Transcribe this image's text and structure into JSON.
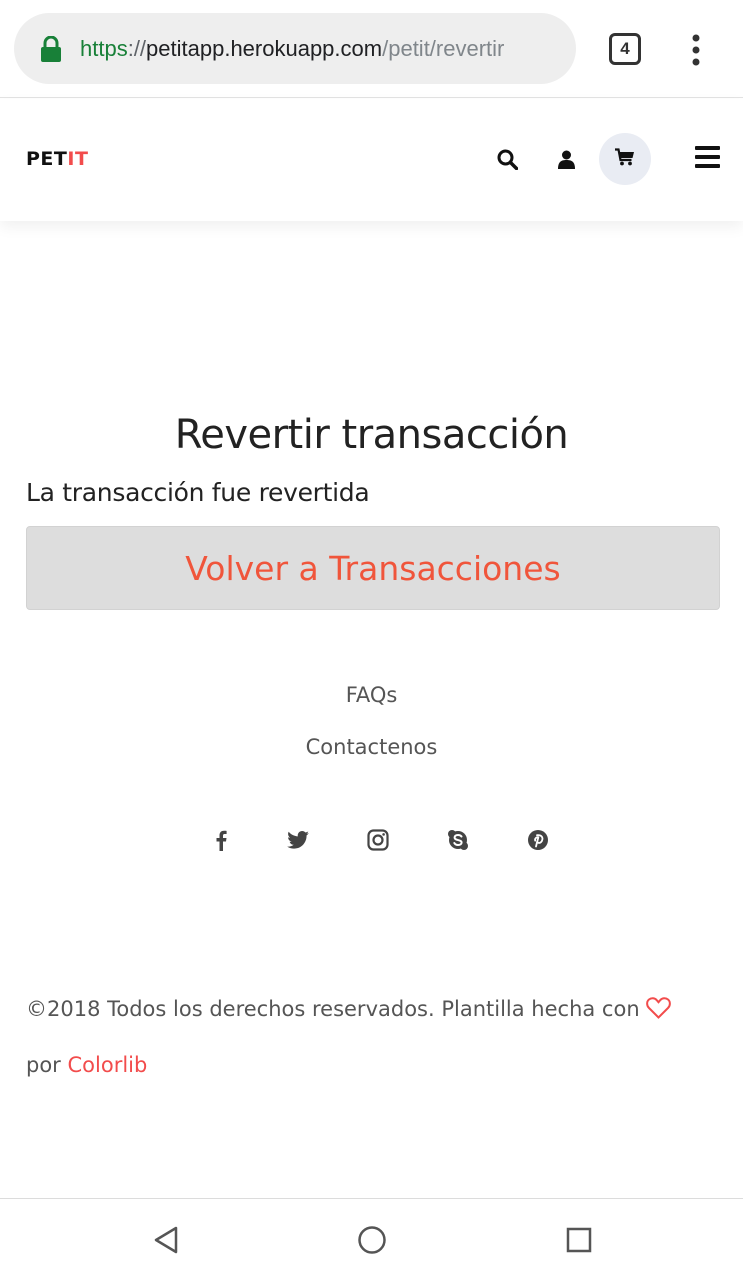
{
  "browser": {
    "url_scheme": "https",
    "url_separator": "://",
    "url_host": "petitapp.herokuapp.com",
    "url_path": "/petit/revertir",
    "tab_count": "4"
  },
  "header": {
    "logo_main": "PET",
    "logo_accent": "IT",
    "logo_accent_color": "#f24c4c",
    "icons": [
      "search-icon",
      "user-icon",
      "cart-icon",
      "hamburger-menu-icon"
    ]
  },
  "main": {
    "title": "Revertir transacción",
    "message": "La transacción fue revertida",
    "back_button_label": "Volver a Transacciones",
    "button_text_color": "#f0553b"
  },
  "footer": {
    "links": [
      "FAQs",
      "Contactenos"
    ],
    "social_icons": [
      "facebook-icon",
      "twitter-icon",
      "instagram-icon",
      "skype-icon",
      "pinterest-icon"
    ],
    "copyright_text": "©2018 Todos los derechos reservados. Plantilla hecha con",
    "by_text": "por",
    "credit_link": "Colorlib"
  },
  "android_nav": {
    "buttons": [
      "back-icon",
      "home-icon",
      "recents-icon"
    ]
  }
}
